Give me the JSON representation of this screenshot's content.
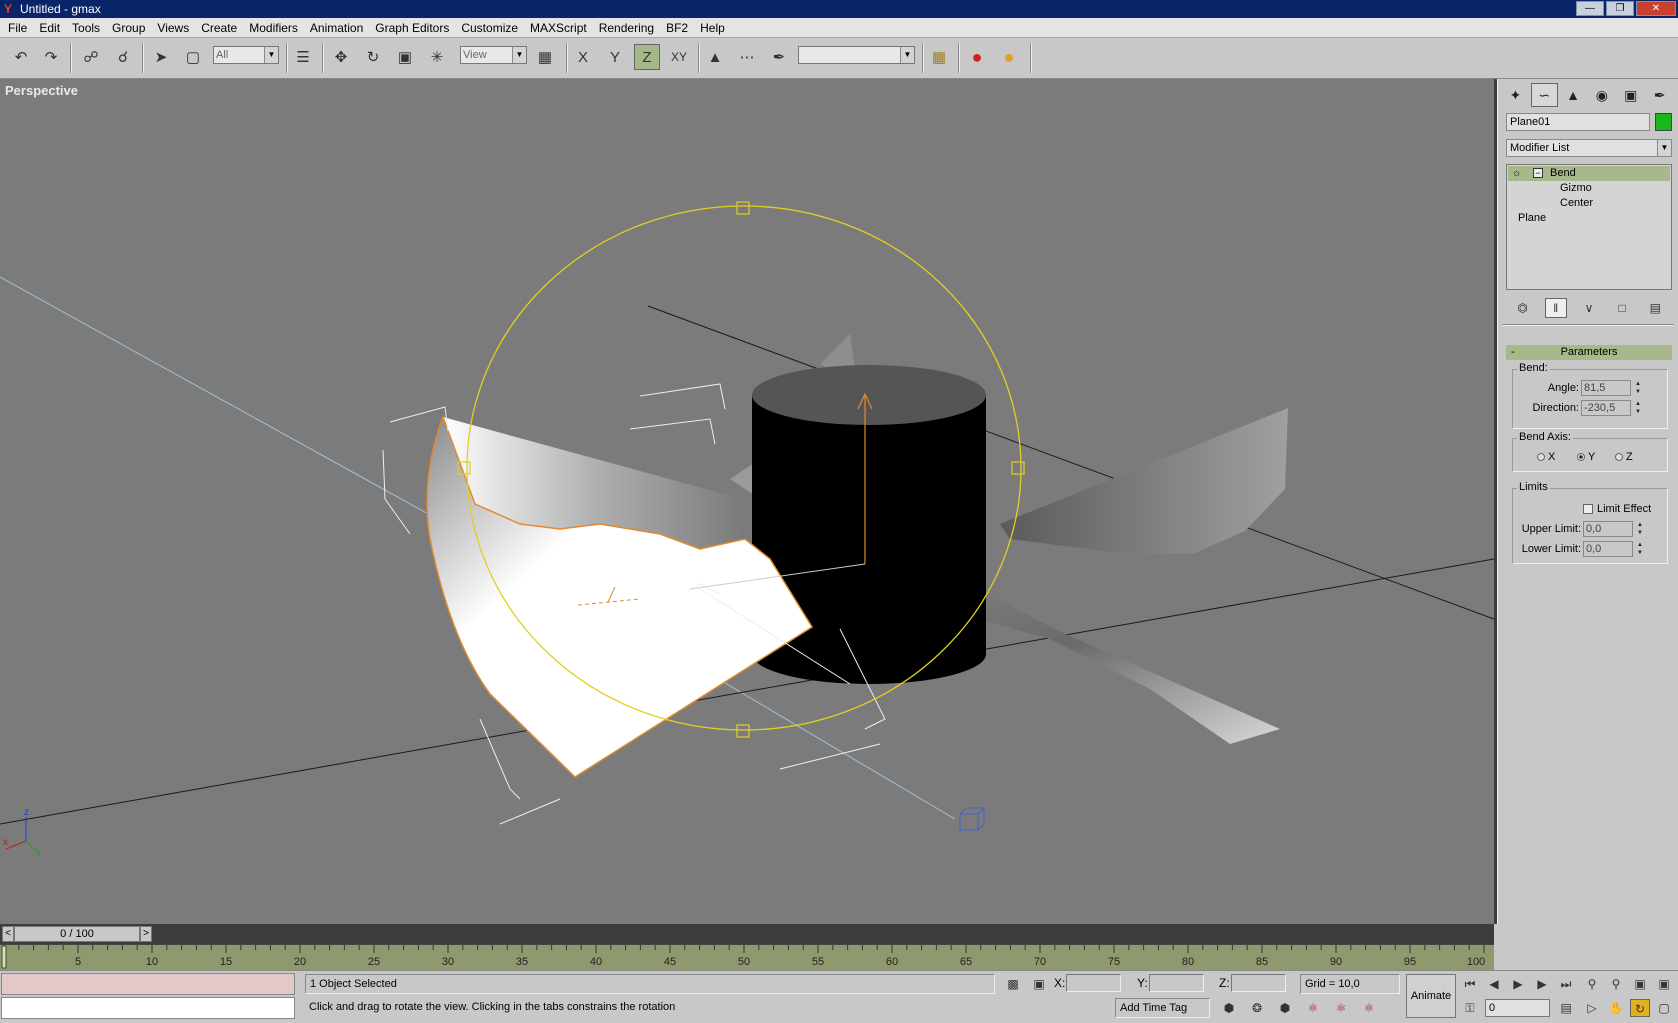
{
  "window": {
    "title": "Untitled - gmax",
    "app_icon": "Y"
  },
  "menu": [
    "File",
    "Edit",
    "Tools",
    "Group",
    "Views",
    "Create",
    "Modifiers",
    "Animation",
    "Graph Editors",
    "Customize",
    "MAXScript",
    "Rendering",
    "BF2",
    "Help"
  ],
  "toolbar": {
    "selection_filter": "All",
    "ref_coord": "View",
    "axis_x": "X",
    "axis_y": "Y",
    "axis_z": "Z",
    "axis_xy": "XY",
    "named_selection": ""
  },
  "viewport": {
    "label": "Perspective",
    "axis_tripod": {
      "z": "z",
      "x": "x",
      "y": "y"
    }
  },
  "command_panel": {
    "object_name": "Plane01",
    "object_color": "#18b818",
    "modifier_list": "Modifier List",
    "stack": [
      {
        "label": "Bend",
        "selected": true
      },
      {
        "label": "Gizmo"
      },
      {
        "label": "Center"
      },
      {
        "label": "Plane"
      }
    ],
    "rollout": {
      "title": "Parameters",
      "toggle": "-",
      "bend_group": "Bend:",
      "angle_label": "Angle:",
      "angle_value": "81,5",
      "direction_label": "Direction:",
      "direction_value": "-230,5",
      "bend_axis_group": "Bend Axis:",
      "axis_x": "X",
      "axis_y": "Y",
      "axis_z": "Z",
      "selected_axis": "Y",
      "limits_group": "Limits",
      "limit_effect": "Limit Effect",
      "upper_label": "Upper Limit:",
      "upper_value": "0,0",
      "lower_label": "Lower Limit:",
      "lower_value": "0,0"
    }
  },
  "timeslider": {
    "frame_label": "0 / 100",
    "prev": "<",
    "next": ">"
  },
  "trackbar": {
    "ticks": [
      "5",
      "10",
      "15",
      "20",
      "25",
      "30",
      "35",
      "40",
      "45",
      "50",
      "55",
      "60",
      "65",
      "70",
      "75",
      "80",
      "85",
      "90",
      "95",
      "100"
    ]
  },
  "status": {
    "selection": "1 Object Selected",
    "prompt": "Click and drag to rotate the view.  Clicking in the tabs constrains the rotation",
    "x_label": "X:",
    "y_label": "Y:",
    "z_label": "Z:",
    "grid": "Grid = 10,0",
    "add_time_tag": "Add Time Tag",
    "animate": "Animate",
    "current_frame": "0"
  },
  "colors": {
    "viewport_bg": "#7b7b7b",
    "selection_highlight": "#a7b88a",
    "gizmo_yellow": "#e0d020",
    "selection_orange": "#e08a30"
  }
}
